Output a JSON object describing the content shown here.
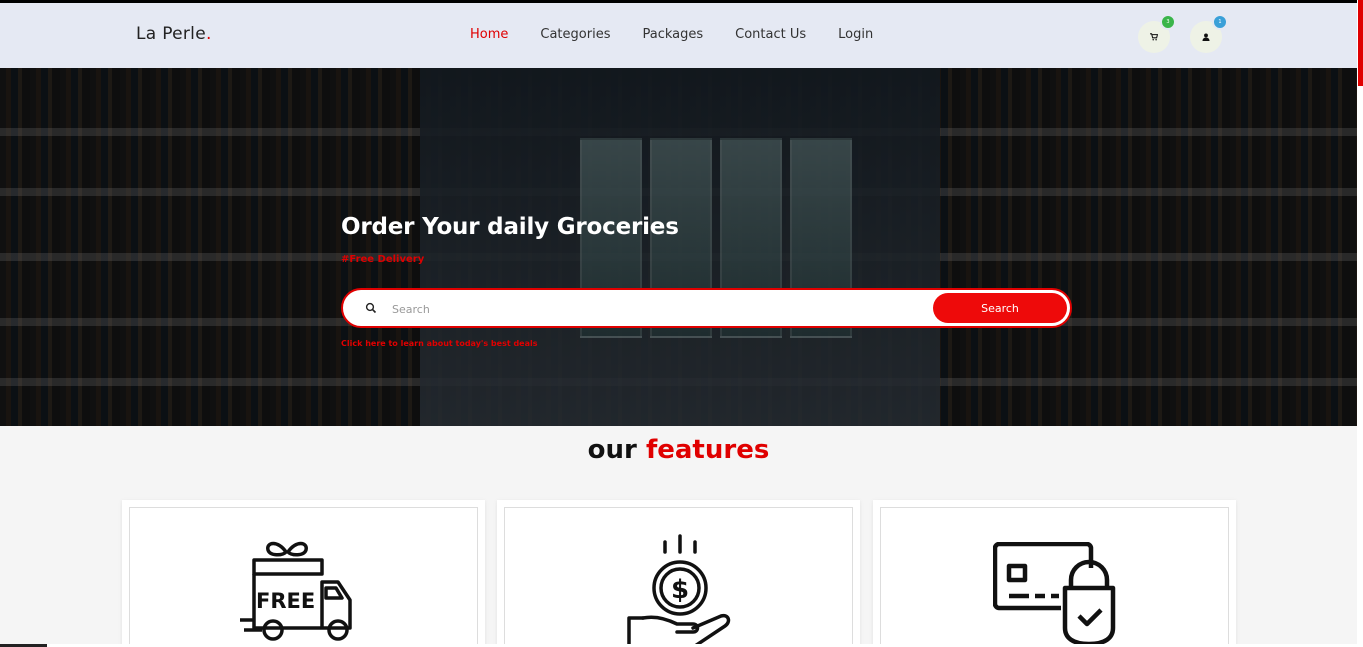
{
  "header": {
    "logo_text": "La Perle",
    "logo_dot": ".",
    "nav": [
      {
        "label": "Home",
        "active": true
      },
      {
        "label": "Categories"
      },
      {
        "label": "Packages"
      },
      {
        "label": "Contact Us"
      },
      {
        "label": "Login"
      }
    ],
    "cart_badge": "3",
    "user_badge": "1"
  },
  "hero": {
    "title": "Order Your daily Groceries",
    "subtitle": "#Free Delivery",
    "search": {
      "placeholder": "Search",
      "button_label": "Search"
    },
    "deals_link": "Click here to learn about today's best deals"
  },
  "features": {
    "title_plain": "our",
    "title_accent": "features",
    "cards": [
      {
        "icon": "free-delivery-truck-icon",
        "truck_text": "FREE"
      },
      {
        "icon": "money-hand-icon",
        "coin_symbol": "$"
      },
      {
        "icon": "secure-card-icon"
      }
    ]
  },
  "colors": {
    "accent": "#e00000",
    "header_bg": "#e5e9f3",
    "badge_green": "#3ab54a",
    "badge_blue": "#3aa0d8"
  }
}
